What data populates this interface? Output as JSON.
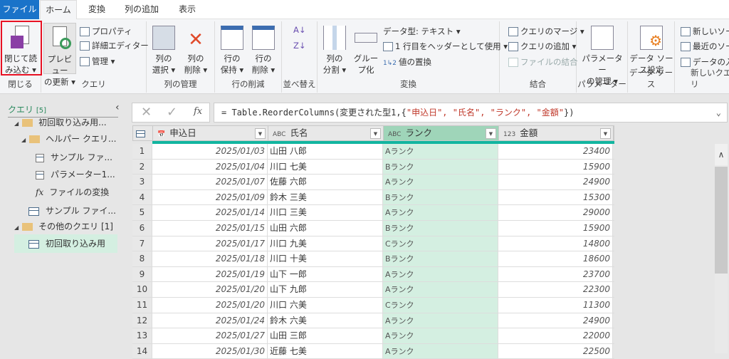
{
  "tabs": [
    "ファイル",
    "ホーム",
    "変換",
    "列の追加",
    "表示"
  ],
  "ribbon": {
    "close": {
      "btn1": "閉じて読",
      "btn2": "み込む ▾",
      "label": "閉じる"
    },
    "query": {
      "refresh1": "プレビュー",
      "refresh2": "の更新 ▾",
      "properties": "プロパティ",
      "advanced": "詳細エディター",
      "manage": "管理 ▾",
      "label": "クエリ"
    },
    "columns": {
      "choose1": "列の",
      "choose2": "選択 ▾",
      "remove1": "列の",
      "remove2": "削除 ▾",
      "label": "列の管理"
    },
    "rows": {
      "keep1": "行の",
      "keep2": "保持 ▾",
      "remove1": "行の",
      "remove2": "削除 ▾",
      "label": "行の削減"
    },
    "sort": {
      "label": "並べ替え"
    },
    "transform": {
      "split1": "列の",
      "split2": "分割 ▾",
      "group1": "グルー",
      "group2": "プ化",
      "datatype": "データ型: テキスト ▾",
      "header": "1 行目をヘッダーとして使用 ▾",
      "replace": "値の置換",
      "label": "変換"
    },
    "combine": {
      "merge": "クエリのマージ ▾",
      "append": "クエリの追加 ▾",
      "files": "ファイルの結合",
      "label": "結合"
    },
    "params": {
      "btn1": "パラメーター",
      "btn2": "の管理 ▾",
      "label": "パラメーター"
    },
    "datasource": {
      "btn1": "データ ソー",
      "btn2": "ス設定",
      "label": "データ ソース"
    },
    "newquery": {
      "new": "新しいソース",
      "recent": "最近のソース",
      "enter": "データの入力",
      "label": "新しいクエリ"
    }
  },
  "queries": {
    "title": "クエリ",
    "count": "[5]",
    "items": [
      "初回取り込み用...",
      "ヘルパー クエリ...",
      "サンプル ファ...",
      "パラメーター1...",
      "ファイルの変換",
      "サンプル ファイ...",
      "その他のクエリ [1]",
      "初回取り込み用"
    ]
  },
  "formula": {
    "prefix": "= Table.ReorderColumns(変更された型1,{",
    "args": "\"申込日\", \"氏名\", \"ランク\", \"金額\"",
    "suffix": "})",
    "fx": "fx"
  },
  "columns": [
    {
      "type": "📅",
      "name": "申込日"
    },
    {
      "type": "ABC",
      "name": "氏名"
    },
    {
      "type": "ABC",
      "name": "ランク"
    },
    {
      "type": "123",
      "name": "金額"
    }
  ],
  "rows": [
    [
      "1",
      "2025/01/03",
      "山田 八郎",
      "Aランク",
      "23400"
    ],
    [
      "2",
      "2025/01/04",
      "川口 七美",
      "Bランク",
      "15900"
    ],
    [
      "3",
      "2025/01/07",
      "佐藤 六郎",
      "Aランク",
      "24900"
    ],
    [
      "4",
      "2025/01/09",
      "鈴木 三美",
      "Bランク",
      "15300"
    ],
    [
      "5",
      "2025/01/14",
      "川口 三美",
      "Aランク",
      "29000"
    ],
    [
      "6",
      "2025/01/15",
      "山田 六郎",
      "Bランク",
      "15900"
    ],
    [
      "7",
      "2025/01/17",
      "川口 九美",
      "Cランク",
      "14800"
    ],
    [
      "8",
      "2025/01/18",
      "川口 十美",
      "Bランク",
      "18600"
    ],
    [
      "9",
      "2025/01/19",
      "山下 一郎",
      "Aランク",
      "23700"
    ],
    [
      "10",
      "2025/01/20",
      "山下 九郎",
      "Aランク",
      "22300"
    ],
    [
      "11",
      "2025/01/20",
      "川口 六美",
      "Cランク",
      "11300"
    ],
    [
      "12",
      "2025/01/24",
      "鈴木 六美",
      "Aランク",
      "24900"
    ],
    [
      "13",
      "2025/01/27",
      "山田 三郎",
      "Aランク",
      "22000"
    ],
    [
      "14",
      "2025/01/30",
      "近藤 七美",
      "Aランク",
      "22500"
    ]
  ],
  "colors": {
    "file_tab": "#1a73c9",
    "selected_column": "#d4efe1",
    "teal": "#12b5a0",
    "highlight": "#e81123"
  }
}
